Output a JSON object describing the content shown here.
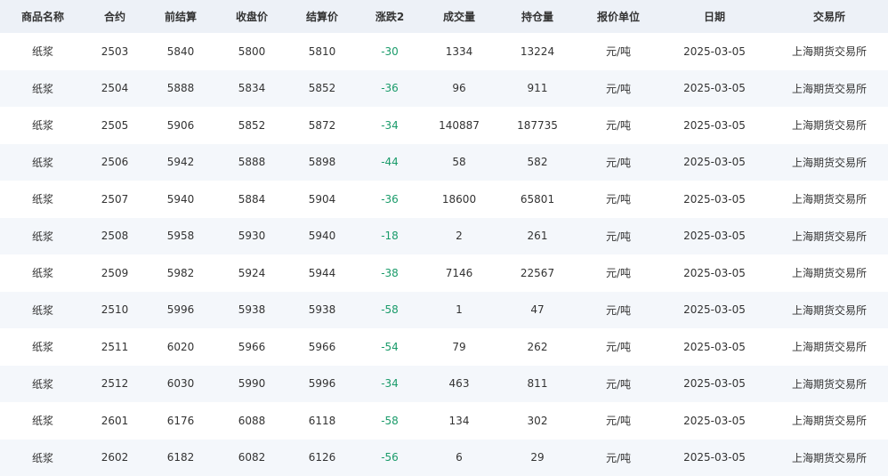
{
  "columns": [
    "商品名称",
    "合约",
    "前结算",
    "收盘价",
    "结算价",
    "涨跌2",
    "成交量",
    "持仓量",
    "报价单位",
    "日期",
    "交易所"
  ],
  "rows": [
    [
      "纸浆",
      "2503",
      "5840",
      "5800",
      "5810",
      "-30",
      "1334",
      "13224",
      "元/吨",
      "2025-03-05",
      "上海期货交易所"
    ],
    [
      "纸浆",
      "2504",
      "5888",
      "5834",
      "5852",
      "-36",
      "96",
      "911",
      "元/吨",
      "2025-03-05",
      "上海期货交易所"
    ],
    [
      "纸浆",
      "2505",
      "5906",
      "5852",
      "5872",
      "-34",
      "140887",
      "187735",
      "元/吨",
      "2025-03-05",
      "上海期货交易所"
    ],
    [
      "纸浆",
      "2506",
      "5942",
      "5888",
      "5898",
      "-44",
      "58",
      "582",
      "元/吨",
      "2025-03-05",
      "上海期货交易所"
    ],
    [
      "纸浆",
      "2507",
      "5940",
      "5884",
      "5904",
      "-36",
      "18600",
      "65801",
      "元/吨",
      "2025-03-05",
      "上海期货交易所"
    ],
    [
      "纸浆",
      "2508",
      "5958",
      "5930",
      "5940",
      "-18",
      "2",
      "261",
      "元/吨",
      "2025-03-05",
      "上海期货交易所"
    ],
    [
      "纸浆",
      "2509",
      "5982",
      "5924",
      "5944",
      "-38",
      "7146",
      "22567",
      "元/吨",
      "2025-03-05",
      "上海期货交易所"
    ],
    [
      "纸浆",
      "2510",
      "5996",
      "5938",
      "5938",
      "-58",
      "1",
      "47",
      "元/吨",
      "2025-03-05",
      "上海期货交易所"
    ],
    [
      "纸浆",
      "2511",
      "6020",
      "5966",
      "5966",
      "-54",
      "79",
      "262",
      "元/吨",
      "2025-03-05",
      "上海期货交易所"
    ],
    [
      "纸浆",
      "2512",
      "6030",
      "5990",
      "5996",
      "-34",
      "463",
      "811",
      "元/吨",
      "2025-03-05",
      "上海期货交易所"
    ],
    [
      "纸浆",
      "2601",
      "6176",
      "6088",
      "6118",
      "-58",
      "134",
      "302",
      "元/吨",
      "2025-03-05",
      "上海期货交易所"
    ],
    [
      "纸浆",
      "2602",
      "6182",
      "6082",
      "6126",
      "-56",
      "6",
      "29",
      "元/吨",
      "2025-03-05",
      "上海期货交易所"
    ]
  ],
  "colors": {
    "header_bg": "#edf1f7",
    "stripe_bg": "#f4f7fb",
    "text": "#333333",
    "negative_change": "#1a9b6a"
  }
}
